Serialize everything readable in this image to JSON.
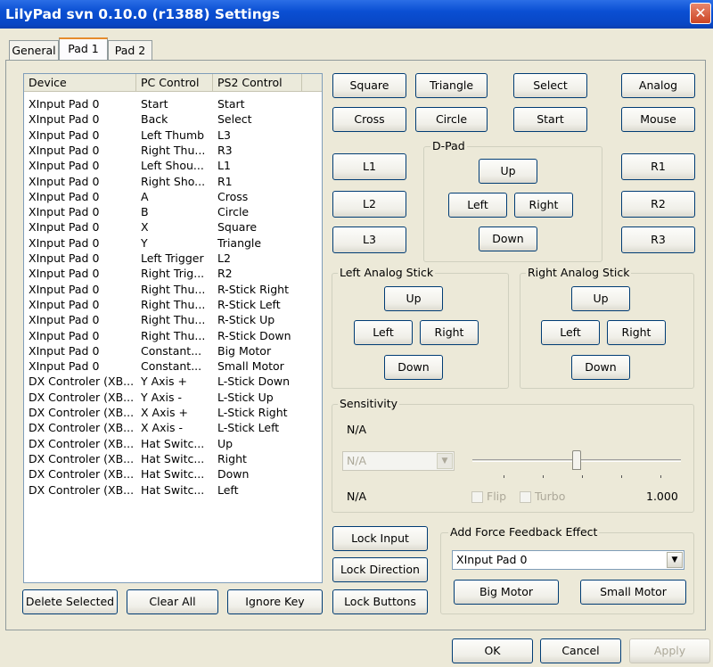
{
  "window": {
    "title": "LilyPad svn 0.10.0 (r1388) Settings",
    "close_glyph": "✕"
  },
  "tabs": [
    {
      "label": "General"
    },
    {
      "label": "Pad 1"
    },
    {
      "label": "Pad 2"
    }
  ],
  "bindings": {
    "columns": [
      "Device",
      "PC Control",
      "PS2 Control"
    ],
    "rows": [
      [
        "XInput Pad 0",
        "Start",
        "Start"
      ],
      [
        "XInput Pad 0",
        "Back",
        "Select"
      ],
      [
        "XInput Pad 0",
        "Left Thumb",
        "L3"
      ],
      [
        "XInput Pad 0",
        "Right Thu...",
        "R3"
      ],
      [
        "XInput Pad 0",
        "Left Shou...",
        "L1"
      ],
      [
        "XInput Pad 0",
        "Right Sho...",
        "R1"
      ],
      [
        "XInput Pad 0",
        "A",
        "Cross"
      ],
      [
        "XInput Pad 0",
        "B",
        "Circle"
      ],
      [
        "XInput Pad 0",
        "X",
        "Square"
      ],
      [
        "XInput Pad 0",
        "Y",
        "Triangle"
      ],
      [
        "XInput Pad 0",
        "Left Trigger",
        "L2"
      ],
      [
        "XInput Pad 0",
        "Right Trig...",
        "R2"
      ],
      [
        "XInput Pad 0",
        "Right Thu...",
        "R-Stick Right"
      ],
      [
        "XInput Pad 0",
        "Right Thu...",
        "R-Stick Left"
      ],
      [
        "XInput Pad 0",
        "Right Thu...",
        "R-Stick Up"
      ],
      [
        "XInput Pad 0",
        "Right Thu...",
        "R-Stick Down"
      ],
      [
        "XInput Pad 0",
        "Constant...",
        "Big Motor"
      ],
      [
        "XInput Pad 0",
        "Constant...",
        "Small Motor"
      ],
      [
        "DX Controler (XB...",
        "Y Axis +",
        "L-Stick Down"
      ],
      [
        "DX Controler (XB...",
        "Y Axis -",
        "L-Stick Up"
      ],
      [
        "DX Controler (XB...",
        "X Axis +",
        "L-Stick Right"
      ],
      [
        "DX Controler (XB...",
        "X Axis -",
        "L-Stick Left"
      ],
      [
        "DX Controler (XB...",
        "Hat Switc...",
        "Up"
      ],
      [
        "DX Controler (XB...",
        "Hat Switc...",
        "Right"
      ],
      [
        "DX Controler (XB...",
        "Hat Switc...",
        "Down"
      ],
      [
        "DX Controler (XB...",
        "Hat Switc...",
        "Left"
      ]
    ]
  },
  "list_buttons": {
    "delete": "Delete Selected",
    "clear": "Clear All",
    "ignore": "Ignore Key"
  },
  "face_buttons": {
    "square": "Square",
    "triangle": "Triangle",
    "select": "Select",
    "analog": "Analog",
    "cross": "Cross",
    "circle": "Circle",
    "start": "Start",
    "mouse": "Mouse"
  },
  "shoulder_buttons": {
    "l1": "L1",
    "l2": "L2",
    "l3": "L3",
    "r1": "R1",
    "r2": "R2",
    "r3": "R3"
  },
  "dpad": {
    "label": "D-Pad",
    "up": "Up",
    "left": "Left",
    "right": "Right",
    "down": "Down"
  },
  "left_stick": {
    "label": "Left Analog Stick",
    "up": "Up",
    "left": "Left",
    "right": "Right",
    "down": "Down"
  },
  "right_stick": {
    "label": "Right Analog Stick",
    "up": "Up",
    "left": "Left",
    "right": "Right",
    "down": "Down"
  },
  "sensitivity": {
    "label": "Sensitivity",
    "top_value": "N/A",
    "select_value": "N/A",
    "bottom_value": "N/A",
    "flip_label": "Flip",
    "turbo_label": "Turbo",
    "amount": "1.000",
    "slider_fraction": 0.5
  },
  "lock_buttons": {
    "input": "Lock Input",
    "direction": "Lock Direction",
    "buttons": "Lock Buttons"
  },
  "force_feedback": {
    "label": "Add Force Feedback Effect",
    "device": "XInput Pad 0",
    "big_motor": "Big Motor",
    "small_motor": "Small Motor"
  },
  "dialog_buttons": {
    "ok": "OK",
    "cancel": "Cancel",
    "apply": "Apply"
  },
  "colors": {
    "title_bar": "#0a4fd3",
    "dialog_bg": "#ece9d8",
    "tab_highlight": "#e68b2c"
  }
}
